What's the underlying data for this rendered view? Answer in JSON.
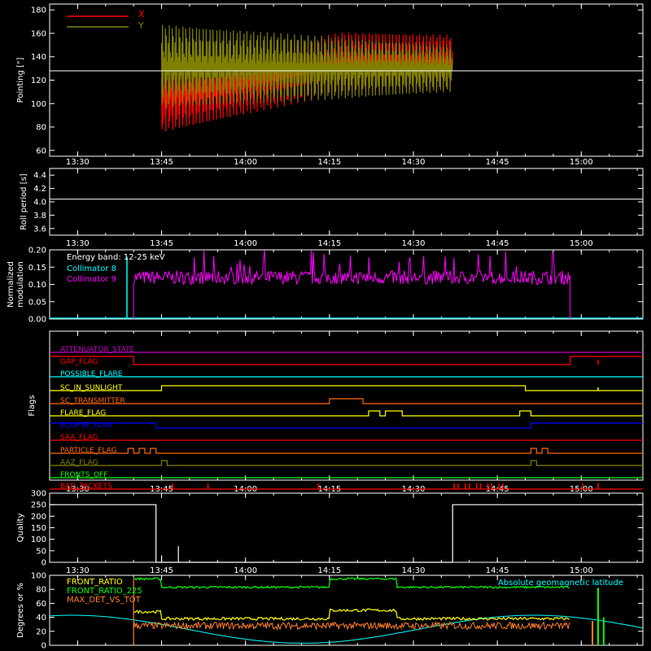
{
  "time_labels": [
    "13:30",
    "13:45",
    "14:00",
    "14:15",
    "14:30",
    "14:45",
    "15:00"
  ],
  "colors": {
    "axis": "#ffffff",
    "x_red": "#ff0000",
    "y_olive": "#808000",
    "cyan": "#00ffff",
    "magenta": "#ff00ff",
    "yellow": "#ffff00",
    "green": "#00ff00",
    "orange": "#ff8c00",
    "blue": "#0000ff",
    "purple": "#c000c0",
    "rate_orange": "#ff7f27",
    "flag_orange": "#ff6600",
    "flag_green": "#00ff00"
  },
  "chart_data": [
    {
      "type": "line",
      "id": "pointing",
      "ylabel": "Pointing [\"]",
      "ylim": [
        55,
        185
      ],
      "yticks": [
        60,
        80,
        100,
        120,
        140,
        160,
        180
      ],
      "legend": [
        "X",
        "Y"
      ],
      "series": [
        {
          "name": "X",
          "color": "#ff0000",
          "start": "13:45",
          "end": "14:37",
          "center_start": 105,
          "center_end": 135,
          "amplitude_start": 30,
          "amplitude_end": 24
        },
        {
          "name": "Y",
          "color": "#808000",
          "start": "13:45",
          "end": "14:37",
          "center_start": 132,
          "center_end": 130,
          "amplitude_start": 36,
          "amplitude_end": 20
        }
      ],
      "reference_line": 128
    },
    {
      "type": "line",
      "id": "roll",
      "ylabel": "Roll period [s]",
      "ylim": [
        3.5,
        4.5
      ],
      "yticks": [
        3.6,
        3.8,
        4.0,
        4.2,
        4.4
      ],
      "series": [
        {
          "name": "",
          "values_constant": 4.04,
          "start": "13:30",
          "end": "15:10"
        }
      ]
    },
    {
      "type": "line",
      "id": "modulation",
      "ylabel": "Normalized modulation",
      "ylim": [
        0,
        0.2
      ],
      "yticks": [
        "0.00",
        "0.05",
        "0.10",
        "0.15",
        "0.20"
      ],
      "annotation": "Energy band: 12-25 keV",
      "legend": [
        "Collimator 8",
        "Collimator 9"
      ],
      "series": [
        {
          "name": "Collimator 8",
          "color": "#00ffff",
          "level": 0.0
        },
        {
          "name": "Collimator 9",
          "color": "#ff00ff",
          "start": "13:40",
          "end": "14:58",
          "level": 0.12
        }
      ]
    },
    {
      "type": "line",
      "id": "flags",
      "ylabel": "Flags",
      "flags": [
        {
          "name": "ATTENUATOR_STATE",
          "color": "#c000c0"
        },
        {
          "name": "GAP_FLAG",
          "color": "#ff0000"
        },
        {
          "name": "POSSIBLE_FLARE",
          "color": "#00ffff"
        },
        {
          "name": "SC_IN_SUNLIGHT",
          "color": "#ffff00"
        },
        {
          "name": "SC_TRANSMITTER",
          "color": "#ff6600"
        },
        {
          "name": "FLARE_FLAG",
          "color": "#ffff00"
        },
        {
          "name": "ECLIPSE_FLAG",
          "color": "#0000ff"
        },
        {
          "name": "SAA_FLAG",
          "color": "#ff0000"
        },
        {
          "name": "PARTICLE_FLAG",
          "color": "#ff6600"
        },
        {
          "name": "AAZ_FLAG",
          "color": "#808000"
        },
        {
          "name": "FRONTS_OFF",
          "color": "#00ff00"
        },
        {
          "name": "BAD_PACKETS",
          "color": "#ff0000"
        }
      ]
    },
    {
      "type": "line",
      "id": "quality",
      "ylabel": "Quality",
      "ylim": [
        0,
        300
      ],
      "yticks": [
        0,
        50,
        100,
        150,
        200,
        250,
        300
      ],
      "series": [
        {
          "name": "",
          "color": "#ffffff"
        }
      ]
    },
    {
      "type": "line",
      "id": "rates",
      "ylabel": "Degrees or %",
      "ylim": [
        0,
        100
      ],
      "yticks": [
        0,
        20,
        40,
        60,
        80,
        100
      ],
      "legend": [
        "FRONT_RATIO",
        "FRONT_RATIO_225",
        "MAX_DET_VS_TOT"
      ],
      "annotation": "Absolute geomagnetic latitude",
      "series": [
        {
          "name": "FRONT_RATIO",
          "color": "#ffff00"
        },
        {
          "name": "FRONT_RATIO_225",
          "color": "#00ff00"
        },
        {
          "name": "MAX_DET_VS_TOT",
          "color": "#ff7f27"
        },
        {
          "name": "Absolute geomagnetic latitude",
          "color": "#00ffff"
        }
      ]
    }
  ]
}
